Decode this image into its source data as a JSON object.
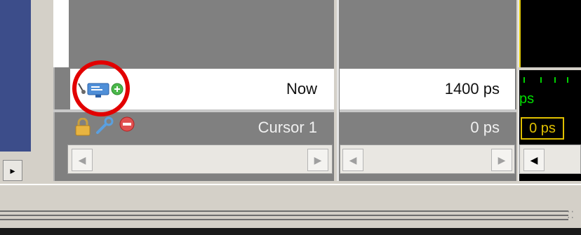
{
  "window": {
    "panes": [
      "names",
      "values",
      "wave"
    ]
  },
  "cursor_rows": [
    {
      "name": "Now",
      "value": "1400 ps"
    },
    {
      "name": "Cursor 1",
      "value": "0 ps"
    }
  ],
  "wave": {
    "now_marker_text": "ps",
    "cursor_box_text": "0 ps"
  },
  "icons": {
    "now_row": [
      "wave-cursor-icon",
      "monitor-icon",
      "add-cursor-icon"
    ],
    "cursor_row": [
      "lock-icon",
      "wrench-icon",
      "delete-cursor-icon"
    ],
    "scroll_left": "arrow-left-icon",
    "scroll_right": "arrow-right-icon"
  },
  "colors": {
    "annotation_circle": "#e20000",
    "wave_background": "#000000",
    "wave_accent": "#e8d000",
    "wave_green": "#00d000"
  }
}
